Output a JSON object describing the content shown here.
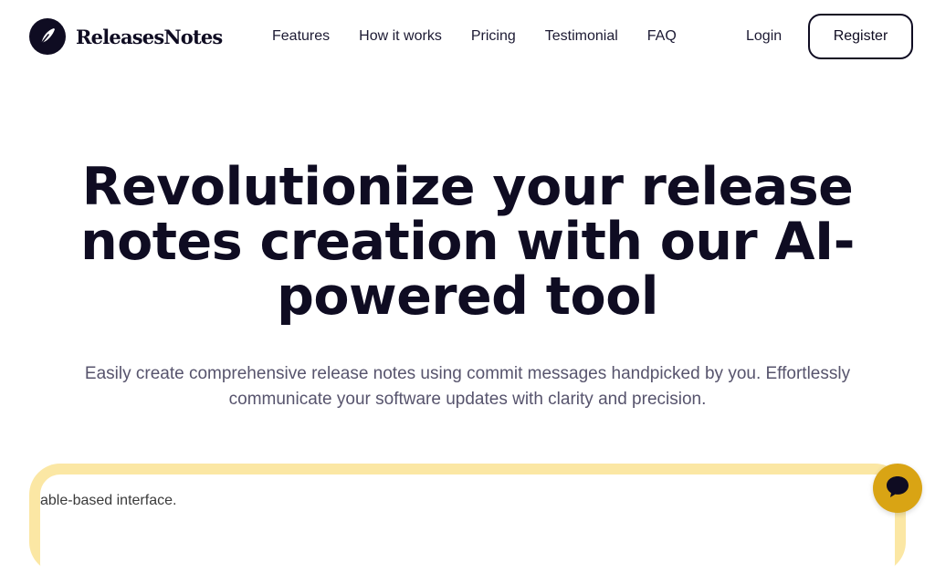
{
  "header": {
    "brand": "ReleasesNotes",
    "nav": [
      "Features",
      "How it works",
      "Pricing",
      "Testimonial",
      "FAQ"
    ],
    "login_label": "Login",
    "register_label": "Register"
  },
  "hero": {
    "title": "Revolutionize your release notes creation with our AI-powered tool",
    "subtitle": "Easily create comprehensive release notes using commit messages handpicked by you. Effortlessly communicate your software updates with clarity and precision."
  },
  "preview": {
    "caption": "able-based interface."
  },
  "icons": {
    "logo": "feather-icon",
    "chat": "chat-bubble-icon"
  },
  "colors": {
    "primary": "#0f0c22",
    "subtitle": "#57546d",
    "preview_frame": "#fbe7a4",
    "chat_button": "#d9a414"
  }
}
